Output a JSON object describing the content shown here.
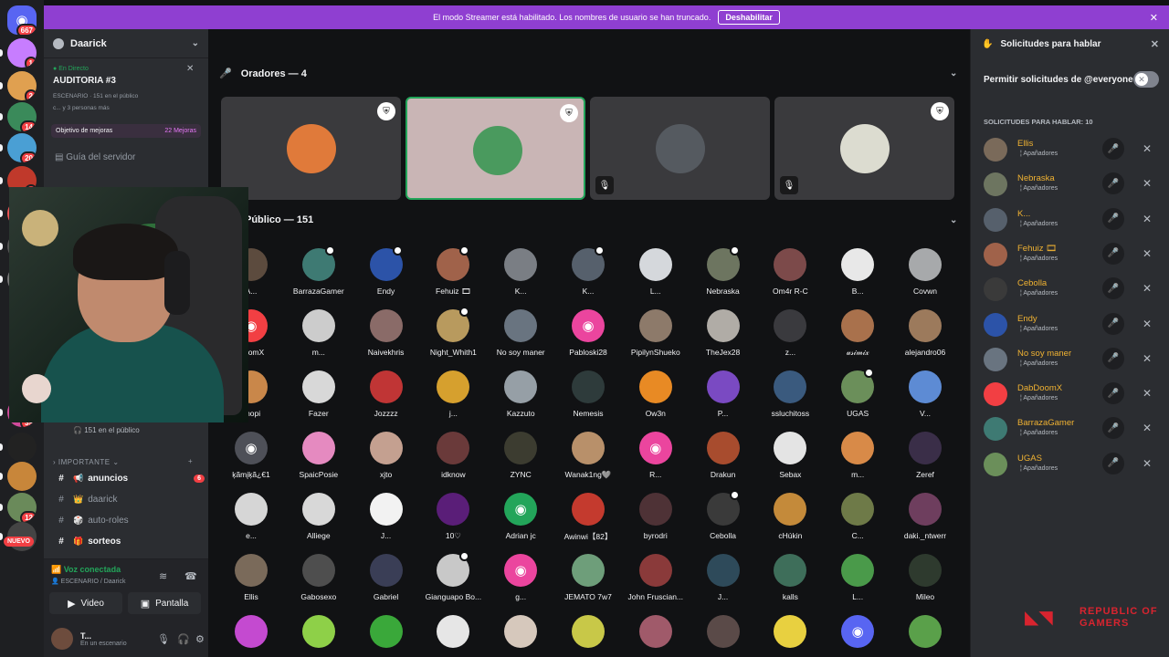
{
  "banner": {
    "text": "El modo Streamer está habilitado. Los nombres de usuario se han truncado.",
    "button": "Deshabilitar"
  },
  "servers": {
    "dm_badge": "667",
    "nuevo": "NUEVO",
    "items": [
      {
        "badge": "1"
      },
      {
        "badge": "2"
      },
      {
        "badge": "14"
      },
      {
        "badge": "20"
      },
      {
        "badge": "1"
      },
      {
        "badge": ""
      },
      {
        "badge": ""
      },
      {
        "badge": ""
      },
      {
        "badge": "39"
      },
      {
        "badge": ""
      },
      {
        "badge": ""
      },
      {
        "badge": "12"
      },
      {
        "badge": ""
      }
    ]
  },
  "sidebar": {
    "server_name": "Daarick",
    "live_tag": "En Directo",
    "stage_title": "AUDITORIA #3",
    "stage_meta": "ESCENARIO · 151 en el público",
    "stage_meta2": "c... y 3 personas más",
    "goal_label": "Objetivo de mejoras",
    "goal_value": "22 Mejoras",
    "guide": "Guía del servidor",
    "public_count": "151 en el público",
    "category": "IMPORTANTE",
    "channels": [
      {
        "name": "anuncios",
        "emoji": "📢",
        "badge": "6",
        "unread": true
      },
      {
        "name": "daarick",
        "emoji": "👑",
        "badge": "",
        "unread": false
      },
      {
        "name": "auto-roles",
        "emoji": "🎲",
        "badge": "",
        "unread": false
      },
      {
        "name": "sorteos",
        "emoji": "🎁",
        "badge": "",
        "unread": true
      }
    ]
  },
  "voice": {
    "status": "Voz conectada",
    "sub": "ESCENARIO / Daarick",
    "video": "Video",
    "screen": "Pantalla"
  },
  "user": {
    "name": "T...",
    "status": "En un escenario"
  },
  "stage": {
    "speakers_header": "Oradores — 4",
    "public_header": "Público — 151"
  },
  "speakers": [
    {
      "color": "#e07a3a",
      "mod": true,
      "mute": false,
      "active": false
    },
    {
      "color": "#4a9a5e",
      "mod": true,
      "mute": false,
      "active": true
    },
    {
      "color": "#555a60",
      "mod": false,
      "mute": true,
      "active": false
    },
    {
      "color": "#dcdcd0",
      "mod": true,
      "mute": true,
      "active": false
    }
  ],
  "audience": [
    {
      "name": "A...",
      "color": "#5c4b3e"
    },
    {
      "name": "BarrazaGamer",
      "color": "#3e7a73"
    },
    {
      "name": "Endy",
      "color": "#2c53a8"
    },
    {
      "name": "Fehuiz 🎞",
      "color": "#a0624a"
    },
    {
      "name": "K...",
      "color": "#7a7e84"
    },
    {
      "name": "K...",
      "color": "#56606c"
    },
    {
      "name": "L...",
      "color": "#d5d8dc"
    },
    {
      "name": "Nebraska",
      "color": "#6d7560"
    },
    {
      "name": "Om4r R-C",
      "color": "#7c4a4a"
    },
    {
      "name": "B...",
      "color": "#e8e8e8"
    },
    {
      "name": "Covwn",
      "color": "#a7a9ab"
    },
    {
      "name": "DoomX",
      "color": "#f23f43"
    },
    {
      "name": "m...",
      "color": "#cccccc"
    },
    {
      "name": "Naivekhris",
      "color": "#8a6b68"
    },
    {
      "name": "Night_Whith1",
      "color": "#b89a5e"
    },
    {
      "name": "No soy maner",
      "color": "#697480"
    },
    {
      "name": "Pabloski28",
      "color": "#eb459e"
    },
    {
      "name": "PipilynShueko",
      "color": "#8d7a6a"
    },
    {
      "name": "TheJex28",
      "color": "#b0aca6"
    },
    {
      "name": "z...",
      "color": "#3a3a3e"
    },
    {
      "name": "𝓊𝓈𝒾𝓂𝒾𝓍",
      "color": "#a9714c"
    },
    {
      "name": "alejandro06",
      "color": "#9c7a5c"
    },
    {
      "name": "chopi",
      "color": "#c9874a"
    },
    {
      "name": "Fazer",
      "color": "#d8d8d8"
    },
    {
      "name": "Jozzzz",
      "color": "#c03535"
    },
    {
      "name": "j...",
      "color": "#d6a02e"
    },
    {
      "name": "Kazzuto",
      "color": "#969fa6"
    },
    {
      "name": "Nemesis",
      "color": "#2e3b3b"
    },
    {
      "name": "Ow3n",
      "color": "#e88a24"
    },
    {
      "name": "P...",
      "color": "#7a4ac2"
    },
    {
      "name": "ssluchitoss",
      "color": "#3a5a7e"
    },
    {
      "name": "UGAS",
      "color": "#6b8f5a"
    },
    {
      "name": "V...",
      "color": "#5d8bd4"
    },
    {
      "name": "ķãmįķã¿€1",
      "color": "#4e5058"
    },
    {
      "name": "SpaicPosie",
      "color": "#e58ac0"
    },
    {
      "name": "xjto",
      "color": "#c4a090"
    },
    {
      "name": "idknow",
      "color": "#6a3a3a"
    },
    {
      "name": "ZYNC",
      "color": "#3c3c30"
    },
    {
      "name": "Wanak1ng🩶",
      "color": "#b8906a"
    },
    {
      "name": "R...",
      "color": "#eb459e"
    },
    {
      "name": "Drakun",
      "color": "#a84c2e"
    },
    {
      "name": "Sebax",
      "color": "#e4e4e4"
    },
    {
      "name": "m...",
      "color": "#d88a48"
    },
    {
      "name": "Zeref",
      "color": "#3a2e48"
    },
    {
      "name": "e...",
      "color": "#d6d6d6"
    },
    {
      "name": "Alliege",
      "color": "#d8d8d8"
    },
    {
      "name": "J...",
      "color": "#f2f2f2"
    },
    {
      "name": "10♡",
      "color": "#5a1e78"
    },
    {
      "name": "Adrian jc",
      "color": "#23a55a"
    },
    {
      "name": "Awinwi【82】",
      "color": "#c43a2e"
    },
    {
      "name": "byrodri",
      "color": "#4e3236"
    },
    {
      "name": "Cebolla",
      "color": "#3a3a3a"
    },
    {
      "name": "cHúkin",
      "color": "#c48a3a"
    },
    {
      "name": "C...",
      "color": "#6e7a48"
    },
    {
      "name": "daki._ntwerr",
      "color": "#6e3e5e"
    },
    {
      "name": "Ellis",
      "color": "#7a6a5a"
    },
    {
      "name": "Gabosexo",
      "color": "#4e4e4e"
    },
    {
      "name": "Gabriel",
      "color": "#3a3e56"
    },
    {
      "name": "Gianguapo Bo...",
      "color": "#c8c8c8"
    },
    {
      "name": "g...",
      "color": "#eb459e"
    },
    {
      "name": "JEMATO 7w7",
      "color": "#6e9e7a"
    },
    {
      "name": "John Fruscian...",
      "color": "#8a3a3a"
    },
    {
      "name": "J...",
      "color": "#2e4a5a"
    },
    {
      "name": "kalls",
      "color": "#3e6e5a"
    },
    {
      "name": "L...",
      "color": "#4a9a4a"
    },
    {
      "name": "Mileo",
      "color": "#2e3a2e"
    },
    {
      "name": "",
      "color": "#c44ad0"
    },
    {
      "name": "",
      "color": "#8ed048"
    },
    {
      "name": "",
      "color": "#3aa83a"
    },
    {
      "name": "",
      "color": "#e6e6e6"
    },
    {
      "name": "",
      "color": "#d6c8bc"
    },
    {
      "name": "",
      "color": "#c8c848"
    },
    {
      "name": "",
      "color": "#a05a6a"
    },
    {
      "name": "",
      "color": "#5a4a48"
    },
    {
      "name": "",
      "color": "#e8d040"
    },
    {
      "name": "",
      "color": "#5865f2"
    },
    {
      "name": "",
      "color": "#5aa04a"
    }
  ],
  "requests": {
    "title": "Solicitudes para hablar",
    "permit": "Permitir solicitudes de @everyone",
    "label": "SOLICITUDES PARA HABLAR: 10",
    "items": [
      {
        "name": "Ellis",
        "sub": "Apañadores",
        "color": "#7a6a5a"
      },
      {
        "name": "Nebraska",
        "sub": "Apañadores",
        "color": "#6d7560"
      },
      {
        "name": "K...",
        "sub": "Apañadores",
        "color": "#56606c"
      },
      {
        "name": "Fehuiz 🎞",
        "sub": "Apañadores",
        "color": "#a0624a"
      },
      {
        "name": "Cebolla",
        "sub": "Apañadores",
        "color": "#3a3a3a"
      },
      {
        "name": "Endy",
        "sub": "Apañadores",
        "color": "#2c53a8"
      },
      {
        "name": "No soy maner",
        "sub": "Apañadores",
        "color": "#697480"
      },
      {
        "name": "DabDoomX",
        "sub": "Apañadores",
        "color": "#f23f43"
      },
      {
        "name": "BarrazaGamer",
        "sub": "Apañadores",
        "color": "#3e7a73"
      },
      {
        "name": "UGAS",
        "sub": "Apañadores",
        "color": "#6b8f5a"
      }
    ]
  },
  "brand": {
    "line1": "REPUBLIC OF",
    "line2": "GAMERS"
  }
}
